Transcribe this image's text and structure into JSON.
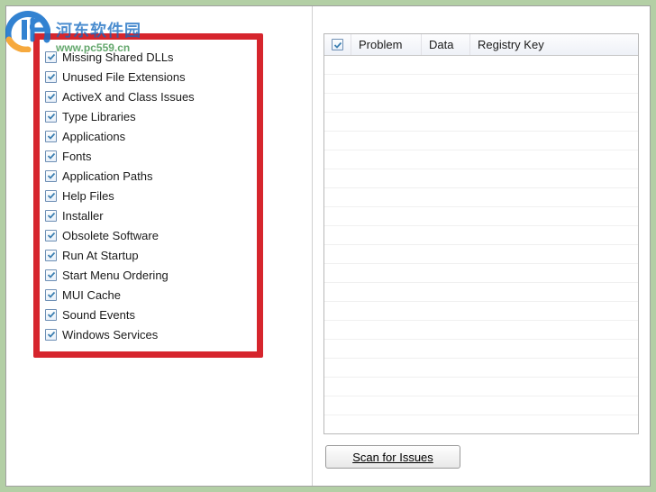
{
  "watermark": {
    "cn": "河东软件园",
    "url": "www.pc559.cn"
  },
  "checklist": {
    "items": [
      {
        "label": "Missing Shared DLLs",
        "checked": true
      },
      {
        "label": "Unused File Extensions",
        "checked": true
      },
      {
        "label": "ActiveX and Class Issues",
        "checked": true
      },
      {
        "label": "Type Libraries",
        "checked": true
      },
      {
        "label": "Applications",
        "checked": true
      },
      {
        "label": "Fonts",
        "checked": true
      },
      {
        "label": "Application Paths",
        "checked": true
      },
      {
        "label": "Help Files",
        "checked": true
      },
      {
        "label": "Installer",
        "checked": true
      },
      {
        "label": "Obsolete Software",
        "checked": true
      },
      {
        "label": "Run At Startup",
        "checked": true
      },
      {
        "label": "Start Menu Ordering",
        "checked": true
      },
      {
        "label": "MUI Cache",
        "checked": true
      },
      {
        "label": "Sound Events",
        "checked": true
      },
      {
        "label": "Windows Services",
        "checked": true
      }
    ]
  },
  "grid": {
    "header": {
      "problem": "Problem",
      "data": "Data",
      "regkey": "Registry Key"
    },
    "empty_rows": 20
  },
  "actions": {
    "scan_label": "Scan for Issues"
  }
}
